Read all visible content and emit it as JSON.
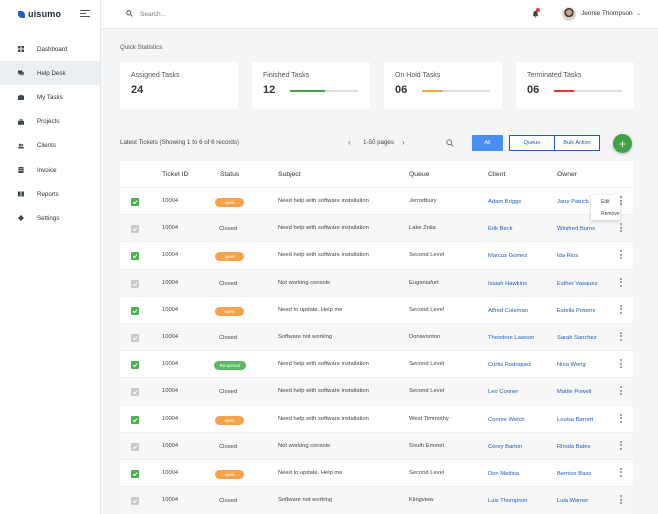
{
  "brand": {
    "name": "uisumo"
  },
  "header": {
    "search_placeholder": "Search...",
    "user_name": "Jennie Thompson"
  },
  "sidebar": {
    "items": [
      {
        "label": "Dashboard",
        "icon": "grid-icon"
      },
      {
        "label": "Help Desk",
        "icon": "chat-icon",
        "active": true
      },
      {
        "label": "My Tasks",
        "icon": "puzzle-icon"
      },
      {
        "label": "Projects",
        "icon": "briefcase-icon"
      },
      {
        "label": "Clients",
        "icon": "users-icon"
      },
      {
        "label": "Invoice",
        "icon": "invoice-icon"
      },
      {
        "label": "Reports",
        "icon": "book-icon"
      },
      {
        "label": "Settings",
        "icon": "gear-icon"
      }
    ]
  },
  "stats": {
    "title": "Quick Statistics",
    "cards": [
      {
        "label": "Assigned Tasks",
        "value": "24"
      },
      {
        "label": "Finished Tasks",
        "value": "12",
        "progress": 0.52,
        "color": "#43a047"
      },
      {
        "label": "On Hold Tasks",
        "value": "06",
        "progress": 0.3,
        "color": "#f7a14a"
      },
      {
        "label": "Terminated Tasks",
        "value": "06",
        "progress": 0.3,
        "color": "#e53935"
      }
    ]
  },
  "tickets": {
    "title": "Latest Tickets  (Showing 1 to 6 of 6 records)",
    "pager": "1-50 pages",
    "buttons": {
      "all": "All",
      "queue": "Queue",
      "bulk": "Bulk Action",
      "add": "+"
    },
    "columns": [
      "Ticket ID",
      "Status",
      "Subject",
      "Queue",
      "Client",
      "Owner"
    ],
    "menu": [
      "Edit",
      "Remove"
    ],
    "rows": [
      {
        "checked": true,
        "id": "10004",
        "status": "open",
        "subject": "Need help with software installation",
        "queue": "Jerrodbury",
        "client": "Adam Briggs",
        "owner": "Jane Patrick"
      },
      {
        "checked": false,
        "id": "10004",
        "status": "Closed",
        "subject": "Need help with software installation",
        "queue": "Lake Zoila",
        "client": "Erik Beck",
        "owner": "Winifred Burns"
      },
      {
        "checked": true,
        "id": "10004",
        "status": "open",
        "subject": "Need help with software installation",
        "queue": "Second Level",
        "client": "Marcus Gomez",
        "owner": "Ida Rios"
      },
      {
        "checked": false,
        "id": "10004",
        "status": "Closed",
        "subject": "Not working console",
        "queue": "Eugeniafurt",
        "client": "Isaiah Hawkins",
        "owner": "Esther Vasquez"
      },
      {
        "checked": true,
        "id": "10004",
        "status": "open",
        "subject": "Need to update. Help me",
        "queue": "Second Level",
        "client": "Alfred Coleman",
        "owner": "Estella Powers"
      },
      {
        "checked": false,
        "id": "10004",
        "status": "Closed",
        "subject": "Software not working",
        "queue": "Donavonton",
        "client": "Theodore Lawson",
        "owner": "Sarah Sanchez"
      },
      {
        "checked": true,
        "id": "10004",
        "status": "Reopened",
        "subject": "Need help with software installation",
        "queue": "Second Level",
        "client": "Curtis Rodriquez",
        "owner": "Nina Wong"
      },
      {
        "checked": false,
        "id": "10004",
        "status": "Closed",
        "subject": "Need help with software installation",
        "queue": "Second Level",
        "client": "Leo Conner",
        "owner": "Mattie Powell"
      },
      {
        "checked": true,
        "id": "10004",
        "status": "open",
        "subject": "Need help with software installation",
        "queue": "West Timmothy",
        "client": "Connor Welch",
        "owner": "Louisa Barrett"
      },
      {
        "checked": false,
        "id": "10004",
        "status": "Closed",
        "subject": "Not working console",
        "queue": "South Emmet",
        "client": "Corey Barton",
        "owner": "Rhoda Bates"
      },
      {
        "checked": true,
        "id": "10004",
        "status": "open",
        "subject": "Need to update. Help me",
        "queue": "Second Level",
        "client": "Don Medina",
        "owner": "Bernice Bass"
      },
      {
        "checked": false,
        "id": "10004",
        "status": "Closed",
        "subject": "Software not working",
        "queue": "Klingview",
        "client": "Luis Thompson",
        "owner": "Lula Warner"
      }
    ]
  }
}
